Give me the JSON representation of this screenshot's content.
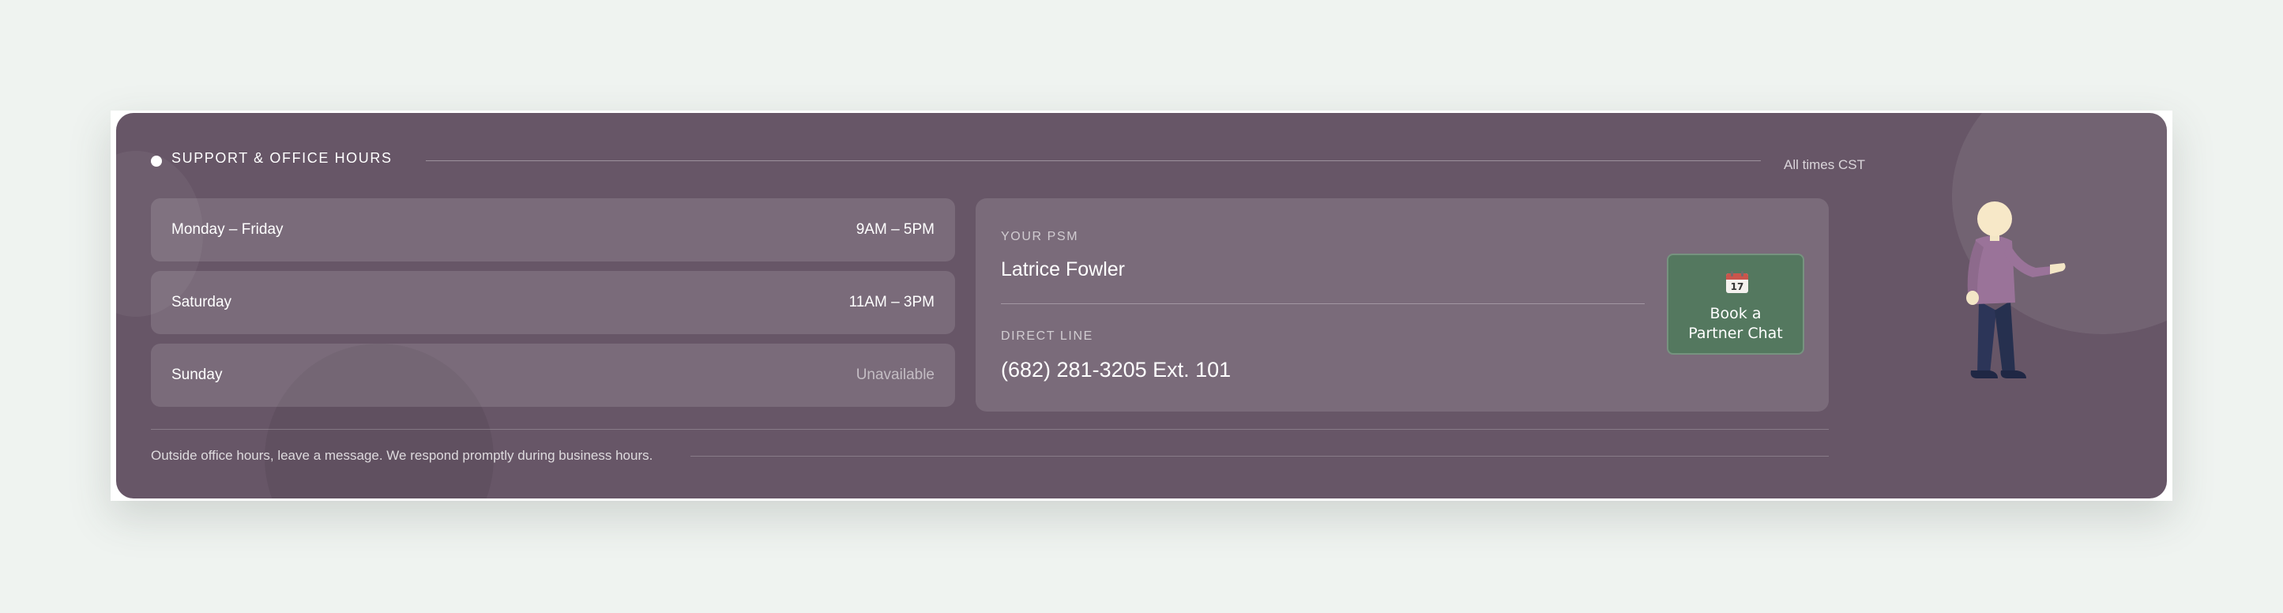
{
  "support": {
    "title": "SUPPORT & OFFICE HOURS",
    "timezone_note": "All times CST",
    "hours": [
      {
        "day": "Monday – Friday",
        "time": "9AM – 5PM"
      },
      {
        "day": "Saturday",
        "time": "11AM – 3PM"
      },
      {
        "day": "Sunday",
        "time": "Unavailable"
      }
    ],
    "footer_note": "Outside office hours, leave a message. We respond promptly during business hours."
  },
  "psm": {
    "eyebrow": "YOUR PSM",
    "name": "Latrice Fowler",
    "direct_line_label": "DIRECT LINE",
    "phone": "(682) 281-3205 Ext. 101"
  },
  "book_button": {
    "label": "Book a\nPartner Chat",
    "icon": "calendar-icon",
    "calendar_day": "17",
    "color": "#54785f"
  },
  "colors": {
    "card_background": "#675667",
    "page_background": "#eff3f0",
    "figure_sweater": "#9a7399",
    "figure_pants": "#2c3558"
  },
  "illustration": {
    "icon": "person-pointing-icon"
  }
}
